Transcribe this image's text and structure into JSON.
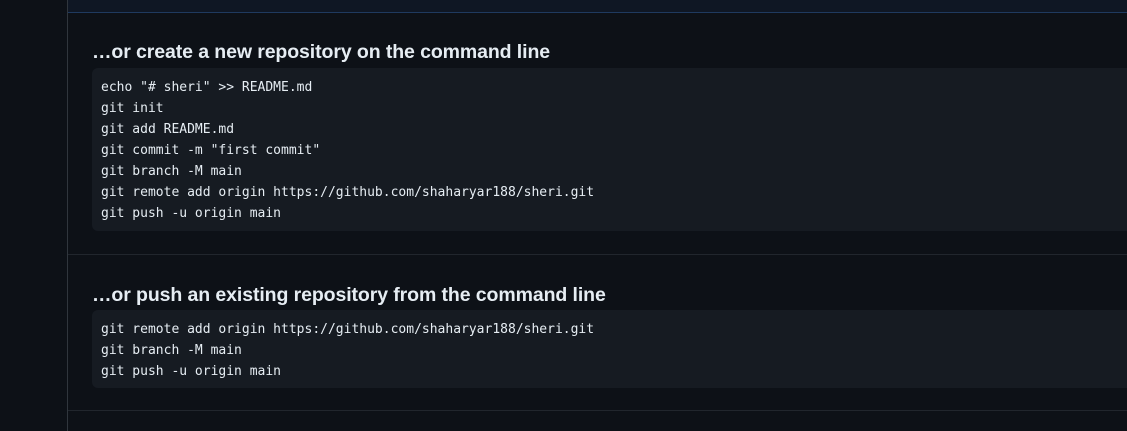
{
  "create_section": {
    "title": "…or create a new repository on the command line",
    "lines": [
      "echo \"# sheri\" >> README.md",
      "git init",
      "git add README.md",
      "git commit -m \"first commit\"",
      "git branch -M main",
      "git remote add origin https://github.com/shaharyar188/sheri.git",
      "git push -u origin main"
    ]
  },
  "push_section": {
    "title": "…or push an existing repository from the command line",
    "lines": [
      "git remote add origin https://github.com/shaharyar188/sheri.git",
      "git branch -M main",
      "git push -u origin main"
    ]
  }
}
